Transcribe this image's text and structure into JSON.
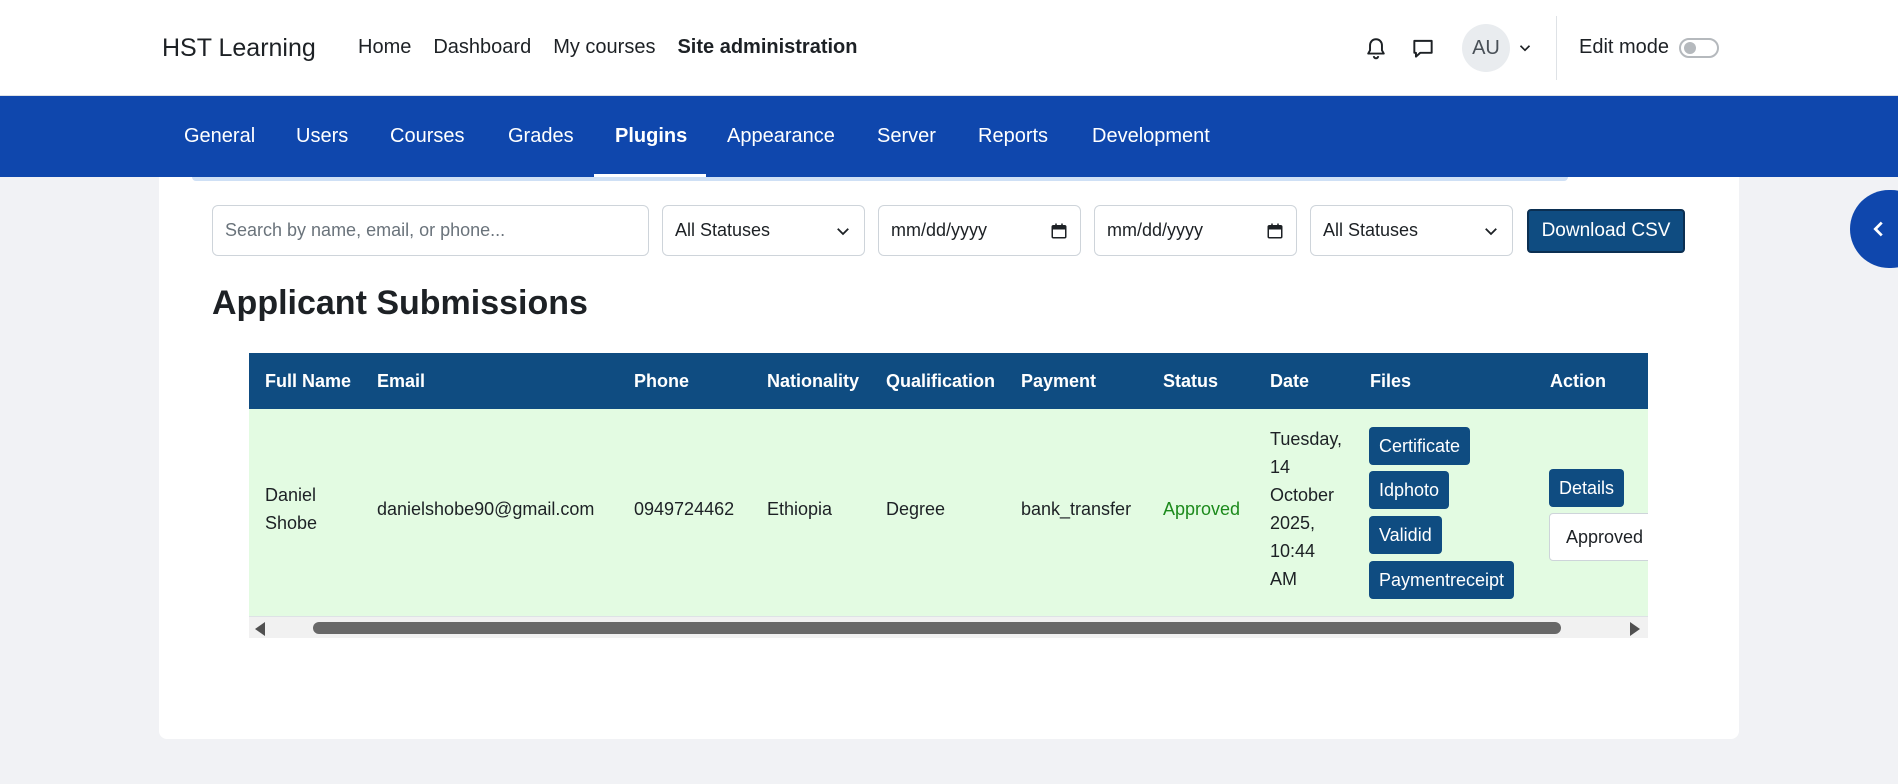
{
  "header": {
    "brand": "HST Learning",
    "nav": [
      "Home",
      "Dashboard",
      "My courses",
      "Site administration"
    ],
    "active_nav": "Site administration",
    "avatar_initials": "AU",
    "edit_mode_label": "Edit mode",
    "edit_mode_on": false
  },
  "secondary_nav": {
    "items": [
      "General",
      "Users",
      "Courses",
      "Grades",
      "Plugins",
      "Appearance",
      "Server",
      "Reports",
      "Development"
    ],
    "active": "Plugins"
  },
  "filters": {
    "search_placeholder": "Search by name, email, or phone...",
    "status_filter_1": "All Statuses",
    "date_from": "mm/dd/yyyy",
    "date_to": "mm/dd/yyyy",
    "status_filter_2": "All Statuses",
    "download_label": "Download CSV"
  },
  "page_title": "Applicant Submissions",
  "table": {
    "columns": [
      "Full Name",
      "Email",
      "Phone",
      "Nationality",
      "Qualification",
      "Payment",
      "Status",
      "Date",
      "Files",
      "Action"
    ],
    "rows": [
      {
        "full_name_line1": "Daniel",
        "full_name_line2": "Shobe",
        "email": "danielshobe90@gmail.com",
        "phone": "0949724462",
        "nationality": "Ethiopia",
        "qualification": "Degree",
        "payment": "bank_transfer",
        "status": "Approved",
        "date_lines": [
          "Tuesday,",
          "14",
          "October",
          "2025,",
          "10:44",
          "AM"
        ],
        "files": [
          "Certificate",
          "Idphoto",
          "Validid",
          "Paymentreceipt"
        ],
        "details_label": "Details",
        "action_value": "Approved"
      }
    ]
  },
  "colors": {
    "nav_blue": "#0f47ad",
    "table_header": "#0f4c81",
    "row_bg": "#e3fbe2",
    "status_green": "#1c8a1c"
  }
}
